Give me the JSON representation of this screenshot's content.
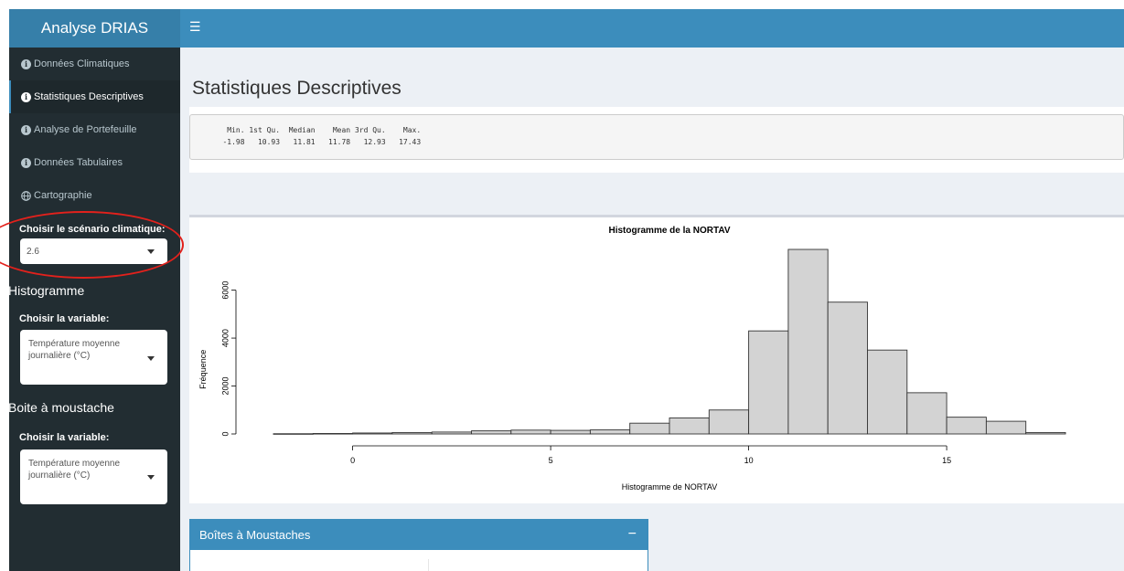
{
  "app": {
    "title": "Analyse DRIAS"
  },
  "sidebar": {
    "items": [
      {
        "label": "Données Climatiques",
        "icon": "info-circle-icon"
      },
      {
        "label": "Statistiques Descriptives",
        "icon": "info-circle-icon",
        "active": true
      },
      {
        "label": "Analyse de Portefeuille",
        "icon": "info-circle-icon"
      },
      {
        "label": "Données Tabulaires",
        "icon": "info-circle-icon"
      },
      {
        "label": "Cartographie",
        "icon": "globe-icon"
      }
    ],
    "scenario_label": "Choisir le scénario climatique:",
    "scenario_value": "2.6",
    "histogram_title": "Histogramme",
    "histogram_var_label": "Choisir la variable:",
    "histogram_var_value": "Température moyenne journalière (°C)",
    "boxplot_title": "Boite à moustache",
    "boxplot_var_label": "Choisir la variable:",
    "boxplot_var_value": "Température moyenne journalière (°C)"
  },
  "main": {
    "title": "Statistiques Descriptives",
    "summary": {
      "headers": [
        "Min.",
        "1st Qu.",
        "Median",
        "Mean",
        "3rd Qu.",
        "Max."
      ],
      "values": [
        "-1.98",
        "10.93",
        "11.81",
        "11.78",
        "12.93",
        "17.43"
      ]
    },
    "boxplot_panel_title": "Boîtes à Moustaches"
  },
  "annotation_color": "#e2211c",
  "chart_data": {
    "type": "bar",
    "title": "Histogramme de la NORTAV",
    "xlabel": "Histogramme de NORTAV",
    "ylabel": "Fréquence",
    "bin_edges": [
      -2,
      -1,
      0,
      1,
      2,
      3,
      4,
      5,
      6,
      7,
      8,
      9,
      10,
      11,
      12,
      13,
      14,
      15,
      16,
      17,
      18
    ],
    "values": [
      10,
      20,
      40,
      60,
      80,
      130,
      160,
      150,
      170,
      450,
      670,
      1000,
      4300,
      7700,
      5500,
      3500,
      1720,
      700,
      530,
      60
    ],
    "xlim": [
      -2,
      18
    ],
    "ylim": [
      0,
      7700
    ],
    "xticks": [
      0,
      5,
      10,
      15
    ],
    "yticks": [
      0,
      2000,
      4000,
      6000
    ],
    "grid": false
  }
}
